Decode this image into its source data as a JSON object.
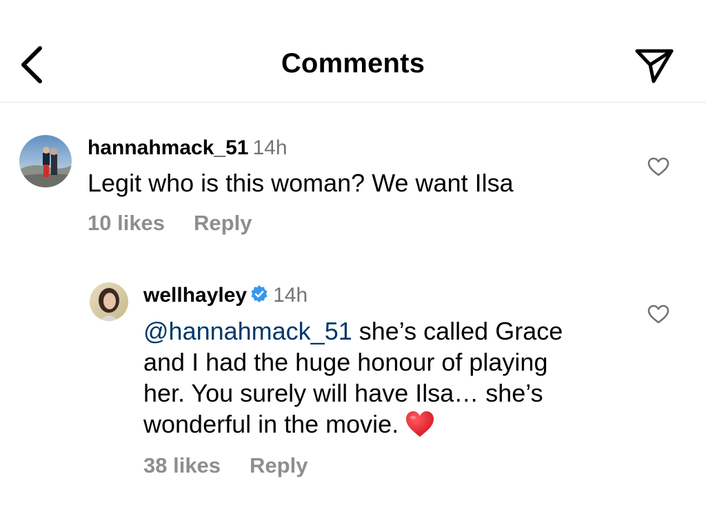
{
  "header": {
    "title": "Comments",
    "back_icon": "chevron-left-icon",
    "share_icon": "paper-plane-icon"
  },
  "comments": [
    {
      "username": "hannahmack_51",
      "time": "14h",
      "text": "Legit who is this woman? We want Ilsa",
      "likes": "10 likes",
      "reply_label": "Reply"
    },
    {
      "username": "wellhayley",
      "verified": true,
      "time": "14h",
      "mention": "@hannahmack_51",
      "text_line1": " she’s called Grace",
      "text_line2": "and I had the huge honour of playing",
      "text_line3": "her. You surely will have Ilsa… she’s",
      "text_line4": "wonderful in the movie.",
      "emoji": "red-heart-icon",
      "likes": "38 likes",
      "reply_label": "Reply"
    }
  ],
  "colors": {
    "secondary_text": "#737373",
    "meta_text": "#8e8e8e",
    "mention": "#00376b",
    "verified": "#3897f0",
    "heart_red": "#e8202a"
  }
}
